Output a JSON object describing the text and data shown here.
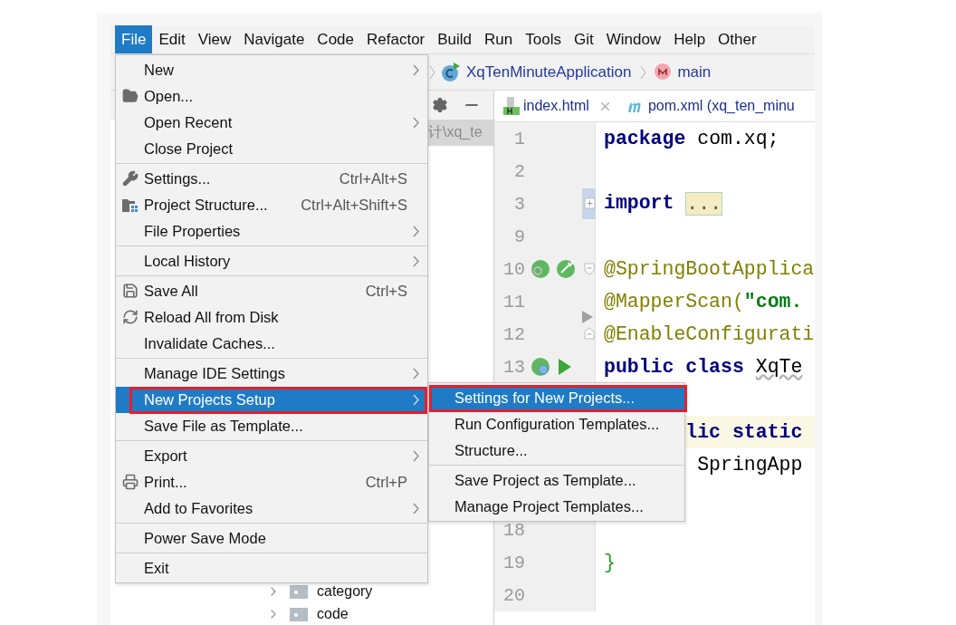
{
  "menu_bar": {
    "items": [
      {
        "label": "File",
        "selected": true
      },
      {
        "label": "Edit",
        "selected": false
      },
      {
        "label": "View",
        "selected": false
      },
      {
        "label": "Navigate",
        "selected": false
      },
      {
        "label": "Code",
        "selected": false
      },
      {
        "label": "Refactor",
        "selected": false
      },
      {
        "label": "Build",
        "selected": false
      },
      {
        "label": "Run",
        "selected": false
      },
      {
        "label": "Tools",
        "selected": false
      },
      {
        "label": "Git",
        "selected": false
      },
      {
        "label": "Window",
        "selected": false
      },
      {
        "label": "Help",
        "selected": false
      },
      {
        "label": "Other",
        "selected": false
      }
    ]
  },
  "breadcrumb": {
    "items": [
      {
        "label": "XqTenMinuteApplication"
      },
      {
        "label": "main"
      }
    ]
  },
  "project_panel": {
    "path": "计\\xq_te",
    "tree": [
      {
        "label": "category",
        "expanded": false
      },
      {
        "label": "code",
        "expanded": false
      }
    ]
  },
  "editor": {
    "tabs": [
      {
        "label": "index.html",
        "closable": true
      },
      {
        "label": "pom.xml (xq_ten_minu",
        "closable": false
      }
    ],
    "lines": [
      {
        "number": "1",
        "kind": "top",
        "current": false,
        "code": [
          {
            "kind": "keyword",
            "text": "package"
          },
          {
            "kind": "plain",
            "text": " com.xq;"
          }
        ]
      },
      {
        "number": "2",
        "kind": "top",
        "current": false
      },
      {
        "number": "3",
        "kind": "top",
        "current": false,
        "code": [
          {
            "kind": "keyword",
            "text": "import "
          },
          {
            "kind": "folded",
            "text": "..."
          }
        ]
      },
      {
        "number": "9",
        "kind": "top",
        "current": false
      },
      {
        "number": "10",
        "kind": "top",
        "current": false,
        "code": [
          {
            "kind": "annotation",
            "text": "@SpringBootApplica"
          }
        ]
      },
      {
        "number": "11",
        "kind": "top",
        "current": false,
        "code": [
          {
            "kind": "annotation",
            "text": "@MapperScan("
          },
          {
            "kind": "string",
            "text": "\"com."
          }
        ]
      },
      {
        "number": "12",
        "kind": "top",
        "current": false,
        "code": [
          {
            "kind": "annotation",
            "text": "@EnableConfigurati"
          }
        ]
      },
      {
        "number": "13",
        "kind": "top",
        "current": false,
        "code": [
          {
            "kind": "keyword",
            "text": "public class "
          },
          {
            "kind": "warning",
            "text": "XqTe"
          }
        ]
      },
      {
        "kind": "top",
        "current": false
      },
      {
        "kind": "method",
        "current": true,
        "code": [
          {
            "kind": "keyword",
            "text": "lic static"
          }
        ]
      },
      {
        "kind": "body",
        "current": false,
        "code": [
          {
            "kind": "plain",
            "text": "SpringApp"
          }
        ]
      },
      {
        "kind": "top",
        "current": false
      },
      {
        "number": "18",
        "kind": "top",
        "current": false
      },
      {
        "number": "19",
        "kind": "top",
        "current": false,
        "code": [
          {
            "kind": "brace",
            "text": "}"
          }
        ]
      },
      {
        "number": "20",
        "kind": "top",
        "current": false
      }
    ]
  },
  "file_menu": {
    "groups": [
      [
        {
          "label": "New",
          "submenu": true,
          "selected": false
        },
        {
          "label": "Open...",
          "submenu": false,
          "selected": false
        },
        {
          "label": "Open Recent",
          "submenu": true,
          "selected": false
        },
        {
          "label": "Close Project",
          "submenu": false,
          "selected": false
        }
      ],
      [
        {
          "label": "Settings...",
          "shortcut": "Ctrl+Alt+S",
          "submenu": false,
          "selected": false
        },
        {
          "label": "Project Structure...",
          "shortcut": "Ctrl+Alt+Shift+S",
          "submenu": false,
          "selected": false
        },
        {
          "label": "File Properties",
          "submenu": true,
          "selected": false
        }
      ],
      [
        {
          "label": "Local History",
          "submenu": true,
          "selected": false
        }
      ],
      [
        {
          "label": "Save All",
          "shortcut": "Ctrl+S",
          "submenu": false,
          "selected": false
        },
        {
          "label": "Reload All from Disk",
          "submenu": false,
          "selected": false
        },
        {
          "label": "Invalidate Caches...",
          "submenu": false,
          "selected": false
        }
      ],
      [
        {
          "label": "Manage IDE Settings",
          "submenu": true,
          "selected": false
        },
        {
          "label": "New Projects Setup",
          "submenu": true,
          "selected": true
        },
        {
          "label": "Save File as Template...",
          "submenu": false,
          "selected": false
        }
      ],
      [
        {
          "label": "Export",
          "submenu": true,
          "selected": false
        },
        {
          "label": "Print...",
          "shortcut": "Ctrl+P",
          "submenu": false,
          "selected": false
        },
        {
          "label": "Add to Favorites",
          "submenu": true,
          "selected": false
        }
      ],
      [
        {
          "label": "Power Save Mode",
          "submenu": false,
          "selected": false
        }
      ],
      [
        {
          "label": "Exit",
          "submenu": false,
          "selected": false
        }
      ]
    ]
  },
  "submenu": {
    "groups": [
      [
        {
          "label": "Settings for New Projects...",
          "submenu": false,
          "selected": true
        },
        {
          "label": "Run Configuration Templates...",
          "submenu": false,
          "selected": false
        },
        {
          "label": "Structure...",
          "submenu": false,
          "selected": false
        }
      ],
      [
        {
          "label": "Save Project as Template...",
          "submenu": false,
          "selected": false
        },
        {
          "label": "Manage Project Templates...",
          "submenu": false,
          "selected": false
        }
      ]
    ]
  }
}
